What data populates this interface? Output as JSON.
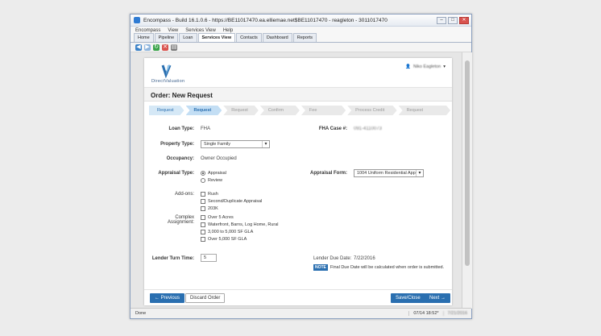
{
  "window": {
    "title": "Encompass - Build 16.1.0.6 - https://BE11017470.ea.elliemae.net$BE11017470 - reagleton - 3011017470"
  },
  "menu": [
    "Encompass",
    "View",
    "Services View",
    "Help"
  ],
  "tabs": [
    "Home",
    "Pipeline",
    "Loan",
    "Services View",
    "Contacts",
    "Dashboard",
    "Reports"
  ],
  "active_tab": "Services View",
  "toolbar_icons": [
    "back-icon",
    "forward-icon",
    "refresh-icon",
    "stop-icon",
    "print-icon"
  ],
  "brand": {
    "name": "DirectValuation"
  },
  "user": {
    "name": "Niko Eagleton"
  },
  "page": {
    "title": "Order: New Request"
  },
  "steps": [
    {
      "label": "Request p1",
      "state": "done"
    },
    {
      "label": "Request p2",
      "state": "active"
    },
    {
      "label": "Request p3",
      "state": "todo"
    },
    {
      "label": "Confirm Order",
      "state": "todo"
    },
    {
      "label": "Fee Confirmation",
      "state": "todo"
    },
    {
      "label": "Process Credit Card",
      "state": "todo"
    },
    {
      "label": "Request Confirmation",
      "state": "todo"
    }
  ],
  "form": {
    "loan_type_label": "Loan Type:",
    "loan_type_value": "FHA",
    "fha_case_label": "FHA Case #:",
    "fha_case_value": "091-4110073",
    "property_type_label": "Property Type:",
    "property_type_value": "Single Family",
    "occupancy_label": "Occupancy:",
    "occupancy_value": "Owner Occupied",
    "appraisal_type_label": "Appraisal Type:",
    "appraisal_options": [
      {
        "label": "Appraisal",
        "checked": true
      },
      {
        "label": "Review",
        "checked": false
      }
    ],
    "appraisal_form_label": "Appraisal Form:",
    "appraisal_form_value": "1004 Uniform Residential Appr",
    "addons_label": "Add-ons:",
    "addons": [
      "Rush",
      "Second/Duplicate Appraisal",
      "203K"
    ],
    "complex_label": "Complex Assignment:",
    "complex": [
      "Over 5 Acres",
      "Waterfront, Barns, Log Home, Rural",
      "3,000 to 5,000 SF GLA",
      "Over 5,000 SF GLA"
    ],
    "turn_time_label": "Lender Turn Time:",
    "turn_time_value": "5",
    "due_date_label": "Lender Due Date:",
    "due_date_value": "7/22/2016",
    "note_tag": "NOTE",
    "note_text": "Final Due Date will be calculated when order is submitted."
  },
  "buttons": {
    "previous": "← Previous",
    "discard": "Discard Order",
    "save_close": "Save/Close",
    "next": "Next →"
  },
  "status": {
    "left": "Done",
    "time": "07/14 18:52*",
    "date": "7/21/2016"
  },
  "colors": {
    "accent": "#2a6fb0",
    "step_done": "#d5e8f6"
  }
}
